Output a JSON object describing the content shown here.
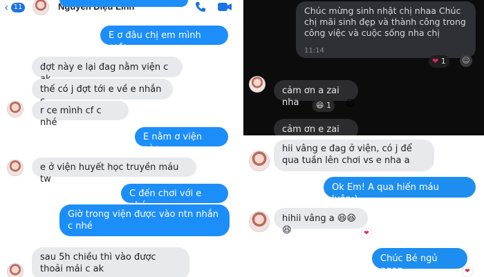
{
  "left": {
    "header": {
      "back_badge": "11",
      "contact_name": "Nguyễn Diệu Linh",
      "call_icon": "phone-icon",
      "video_icon": "video-icon"
    },
    "messages": [
      {
        "text": "E ơ đâu chị em mình cafe",
        "side": "out"
      },
      {
        "text": "đợt này e lại đag nằm viện c ak",
        "side": "in"
      },
      {
        "text": "thế có j đợt tới e về e nhắn c",
        "side": "in"
      },
      {
        "text": "r ce mình cf c nhé",
        "side": "in"
      },
      {
        "text": "E nằm ơ viện nào",
        "side": "out"
      },
      {
        "text": "e ở viện huyết học truyền máu tw",
        "side": "in"
      },
      {
        "text": "C đến chơi với e nhé",
        "side": "out"
      },
      {
        "text": "Giờ trong viện được vào ntn nhắn c nhé",
        "side": "out"
      },
      {
        "text": "sau 5h chiều thì vào được thoải mái  c ak",
        "side": "in"
      }
    ]
  },
  "topright": {
    "message_out": "Chúc mừng sinh nhật chị nhaa Chúc chị mãi sinh đẹp và thành công trong công việc và cuộc sống nha chị",
    "time": "11:14",
    "reaction_count": "1",
    "reply1": "cảm ơn a zai nha",
    "reply1_reaction_count": "1",
    "reply2": "cảm ơn e zai nha"
  },
  "botright": {
    "messages": [
      {
        "text": "hii vâng e đag ở viện, có j để qua tuần lên chơi vs e nha a",
        "side": "in"
      },
      {
        "text": "Ok Em! A qua hiến máu luôn:)",
        "side": "out"
      },
      {
        "text": "hihii vâng a 😆😆😆",
        "side": "in"
      },
      {
        "text": "Chúc Bé ngủ ngon",
        "side": "out"
      }
    ]
  },
  "colors": {
    "messenger_blue": "#1c8ef9",
    "incoming_gray": "#e8e9ed",
    "dark_bg": "#0c0c0c"
  }
}
